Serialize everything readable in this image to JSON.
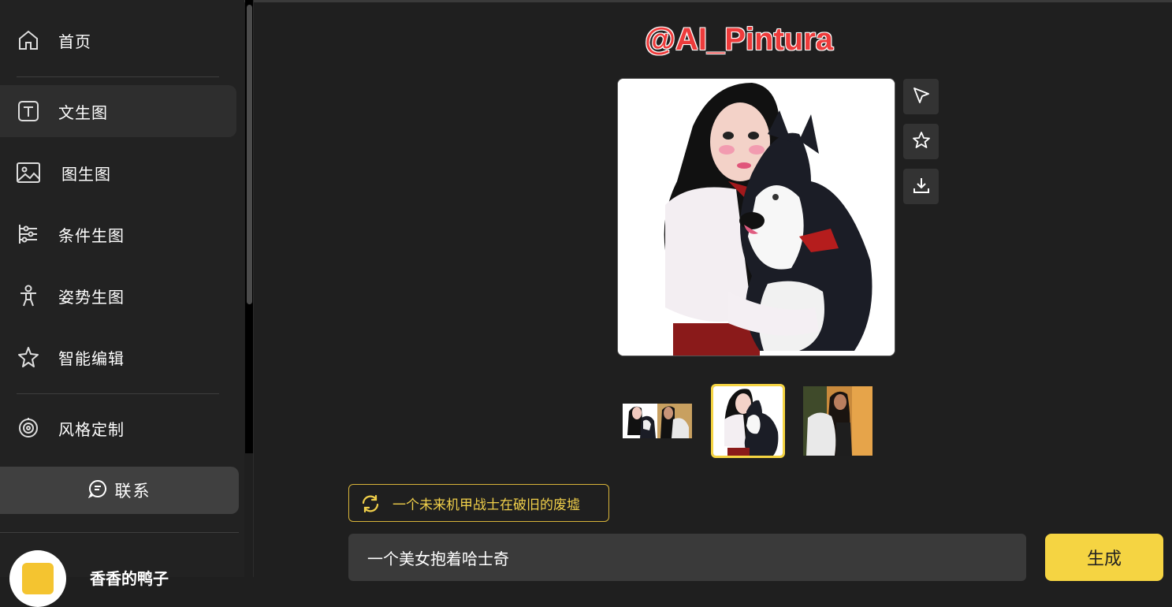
{
  "sidebar": {
    "items": [
      {
        "label": "首页",
        "icon": "home-icon"
      },
      {
        "label": "文生图",
        "icon": "text-box-icon",
        "active": true
      },
      {
        "label": "图生图",
        "icon": "image-icon"
      },
      {
        "label": "条件生图",
        "icon": "sliders-icon"
      },
      {
        "label": "姿势生图",
        "icon": "person-icon"
      },
      {
        "label": "智能编辑",
        "icon": "sparkle-icon"
      },
      {
        "label": "风格定制",
        "icon": "target-icon"
      }
    ],
    "contact_label": "联系",
    "user_name": "香香的鸭子"
  },
  "main": {
    "brand": "@AI_Pintura",
    "suggestion": "一个未来机甲战士在破旧的废墟",
    "prompt_value": "一个美女抱着哈士奇",
    "generate_label": "生成",
    "selected_thumbnail": 2
  },
  "colors": {
    "accent": "#f5d442",
    "brand": "#ee3b3b",
    "bg": "#1f1f1f",
    "sidebar_bg": "#222222"
  }
}
